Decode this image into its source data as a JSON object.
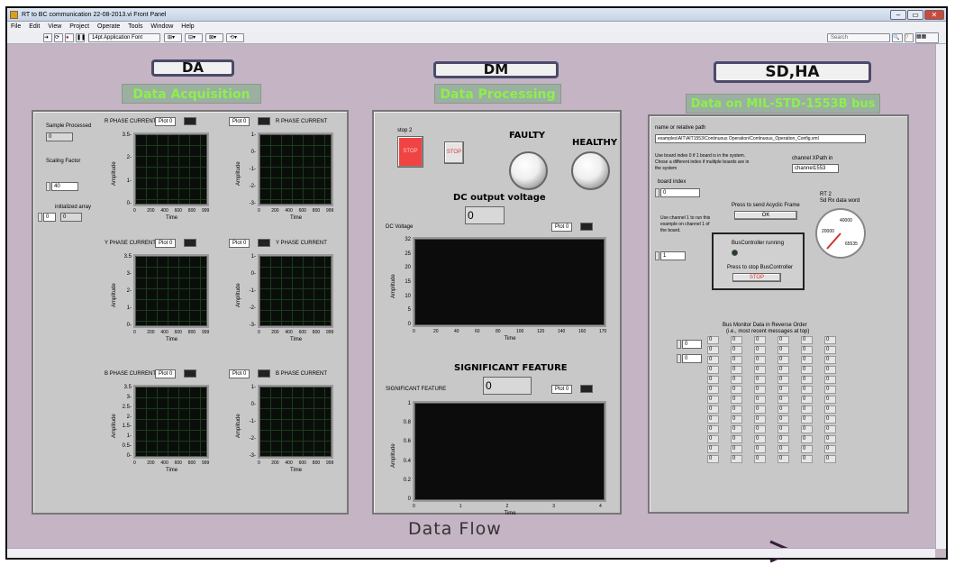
{
  "window": {
    "title": "RT to BC communication 22-08-2013.vi Front Panel",
    "minimize": "–",
    "maximize": "▭",
    "close": "✕"
  },
  "menu": [
    "File",
    "Edit",
    "View",
    "Project",
    "Operate",
    "Tools",
    "Window",
    "Help"
  ],
  "toolbar": {
    "font": "14pt Application Font",
    "search_placeholder": "Search"
  },
  "da": {
    "header": "DA",
    "subtitle": "Data Acquisition",
    "sample_processed_label": "Sample Processed",
    "sample_processed_value": "0",
    "scaling_factor_label": "Scaling Factor",
    "scaling_factor_value": "40",
    "initialized_array_label": "initialized array",
    "initialized_array_index": "0",
    "initialized_array_value": "0",
    "graphs": [
      {
        "title": "R PHASE CURRENT",
        "legend": "Plot 0",
        "yticks": [
          "3.5-",
          "2-",
          "1-",
          "0-"
        ],
        "xticks": [
          "0",
          "200",
          "400",
          "600",
          "800",
          "999"
        ],
        "xlabel": "Time",
        "ylabel": "Amplitude"
      },
      {
        "title": "R PHASE CURRENT",
        "legend": "Plot 0",
        "yticks": [
          "1-",
          "0-",
          "-1-",
          "-2-",
          "-3-"
        ],
        "xticks": [
          "0",
          "200",
          "400",
          "600",
          "800",
          "999"
        ],
        "xlabel": "Time",
        "ylabel": "Amplitude"
      },
      {
        "title": "Y PHASE CURRENT",
        "legend": "Plot 0",
        "yticks": [
          "3.5",
          "3-",
          "2-",
          "1-",
          "0-"
        ],
        "xticks": [
          "0",
          "200",
          "400",
          "600",
          "800",
          "999"
        ],
        "xlabel": "Time",
        "ylabel": "Amplitude"
      },
      {
        "title": "Y PHASE CURRENT",
        "legend": "Plot 0",
        "yticks": [
          "1-",
          "0-",
          "-1-",
          "-2-",
          "-3-"
        ],
        "xticks": [
          "0",
          "200",
          "400",
          "600",
          "800",
          "999"
        ],
        "xlabel": "Time",
        "ylabel": "Amplitude"
      },
      {
        "title": "B PHASE CURRENT",
        "legend": "Plot 0",
        "yticks": [
          "3.5",
          "3-",
          "2.5-",
          "2-",
          "1.5-",
          "1-",
          "0.5-",
          "0-"
        ],
        "xticks": [
          "0",
          "200",
          "400",
          "600",
          "800",
          "999"
        ],
        "xlabel": "Time",
        "ylabel": "Amplitude"
      },
      {
        "title": "B PHASE CURRENT",
        "legend": "Plot 0",
        "yticks": [
          "1-",
          "0-",
          "-1-",
          "-2-",
          "-3-"
        ],
        "xticks": [
          "0",
          "200",
          "400",
          "600",
          "800",
          "999"
        ],
        "xlabel": "Time",
        "ylabel": "Amplitude"
      }
    ]
  },
  "dm": {
    "header": "DM",
    "subtitle": "Data Processing",
    "stop2_label": "stop 2",
    "stop2_button": "STOP",
    "stop_button": "STOP",
    "faulty_label": "FAULTY",
    "healthy_label": "HEALTHY",
    "dc_output_label": "DC output voltage",
    "dc_output_value": "0",
    "dc_graph": {
      "title": "DC Voltage",
      "legend": "Plot 0",
      "ylabel": "Amplitude",
      "xlabel": "Time",
      "yticks": [
        "32",
        "25",
        "20",
        "15",
        "10",
        "5",
        "0"
      ],
      "xticks": [
        "0",
        "20",
        "40",
        "60",
        "80",
        "100",
        "120",
        "140",
        "160",
        "170"
      ]
    },
    "significant_label": "SIGNIFICANT FEATURE",
    "significant_value": "0",
    "sig_graph": {
      "title": "SIGNIFICANT FEATURE",
      "legend": "Plot 0",
      "ylabel": "Amplitude",
      "xlabel": "Time",
      "yticks": [
        "1",
        "0.8",
        "0.6",
        "0.4",
        "0.2",
        "0"
      ],
      "xticks": [
        "0",
        "1",
        "2",
        "3",
        "4"
      ]
    }
  },
  "sdha": {
    "header": "SD,HA",
    "subtitle": "Data on MIL-STD-1553B bus",
    "path_label": "name or relative path",
    "path_value": "examples\\AIT\\AIT1553\\Continuous Operation\\Continuous_Operation_Config.xml",
    "board_note": "Use board index 0 if 1 board is in the system. Chose a different index if multiple boards are in the system",
    "channel_xpath_label": "channel XPath in",
    "channel_xpath_value": "channel1553",
    "board_index_label": "board index",
    "board_index_value": "0",
    "channel_note": "Use channel 1 to run this example on channel 1 of the board.",
    "channel_value": "1",
    "acyclic_label": "Press to send Acyclic Frame",
    "ok_button": "OK",
    "rt_label": "RT 2",
    "rt_sub": "Sd Rx data word",
    "gauge_ticks": [
      "20000",
      "40000",
      "65535"
    ],
    "bc_running_label": "BusController running",
    "bc_stop_label": "Press to stop BusController",
    "bc_stop_button": "STOP",
    "monitor_title": "Bus Monitor Data in Reverse Order",
    "monitor_sub": "(i.e., most recent messages at top)",
    "monitor_idx1": "0",
    "monitor_idx2": "0",
    "cell_value": "0"
  },
  "data_flow_label": "Data Flow"
}
